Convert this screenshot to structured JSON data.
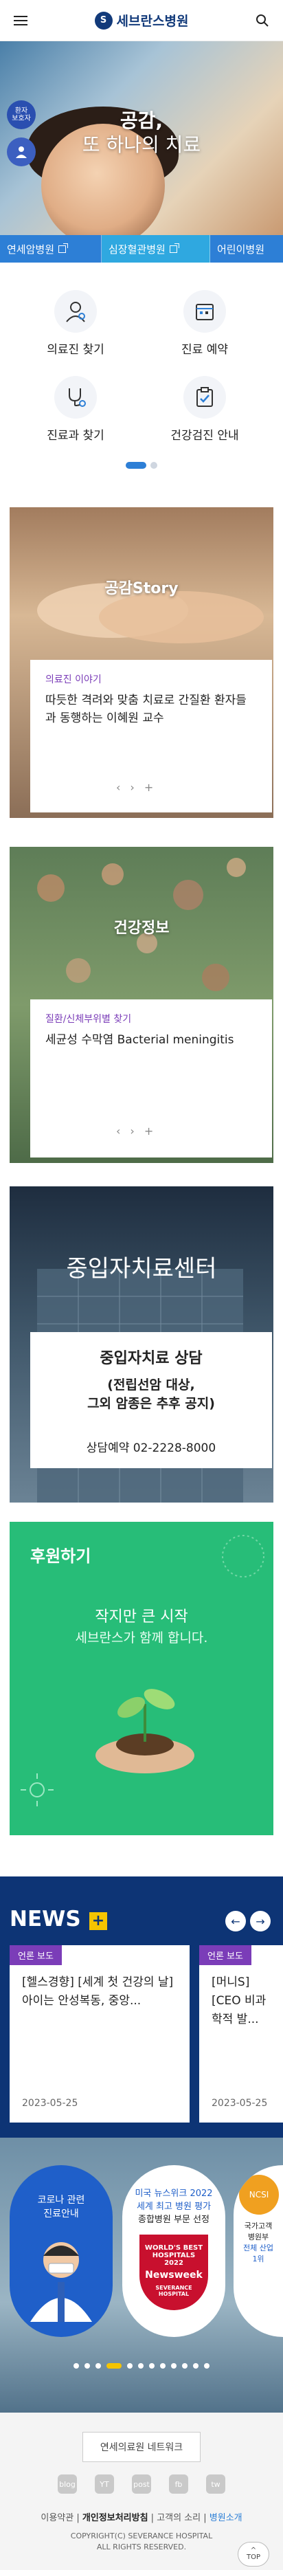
{
  "header": {
    "logo_text": "세브란스병원",
    "logo_mark": "S"
  },
  "hero": {
    "title_line1": "공감,",
    "title_line2": "또 하나의 치료",
    "side_button_label": "환자\n보호자"
  },
  "hospital_tabs": [
    {
      "label": "연세암병원"
    },
    {
      "label": "심장혈관병원"
    },
    {
      "label": "어린이병원"
    }
  ],
  "quick_menu": [
    {
      "label": "의료진 찾기",
      "icon": "doctor-search-icon"
    },
    {
      "label": "진료 예약",
      "icon": "calendar-icon"
    },
    {
      "label": "진료과 찾기",
      "icon": "stethoscope-icon"
    },
    {
      "label": "건강검진 안내",
      "icon": "health-check-icon"
    }
  ],
  "story": {
    "title": "공감Story",
    "category": "의료진 이야기",
    "text": "따듯한 격려와 맞춤 치료로 간질환 환자들과 동행하는 이혜원 교수"
  },
  "health_info": {
    "title": "건강정보",
    "category": "질환/신체부위별 찾기",
    "text": "세균성 수막염 Bacterial meningitis"
  },
  "pager": {
    "prev": "‹",
    "next": "›",
    "add": "+"
  },
  "center": {
    "title": "중입자치료센터",
    "box_title": "중입자치료 상담",
    "box_sub1": "(전립선암 대상,",
    "box_sub2": "그외 암종은 추후 공지)",
    "phone": "상담예약 02-2228-8000"
  },
  "donate": {
    "title": "후원하기",
    "line1": "작지만 큰 시작",
    "line2": "세브란스가 함께 합니다."
  },
  "news": {
    "title": "NEWS",
    "plus": "+",
    "items": [
      {
        "tag": "언론 보도",
        "text": "[헬스경향] [세계 첫 건강의 날] 아이는 안성복동, 중앙...",
        "date": "2023-05-25"
      },
      {
        "tag": "언론 보도",
        "text": "[머니S] [CEO 비과학적 발...",
        "date": "2023-05-25"
      }
    ]
  },
  "banners": [
    {
      "text1": "코로나 관련",
      "text2": "진료안내"
    },
    {
      "text1": "미국 뉴스위크 2022",
      "text2": "세계 최고 병원 평가",
      "text3": "종합병원 부문 선정",
      "badge1": "WORLD'S BEST",
      "badge2": "HOSPITALS",
      "badge3": "2022",
      "badge4": "Newsweek",
      "badge5": "SEVERANCE HOSPITAL"
    },
    {
      "text1": "국가고객",
      "text2": "병원부",
      "text3": "전체 산업",
      "text4": "1위",
      "badge": "NCSI"
    }
  ],
  "footer": {
    "network_label": "연세의료원 네트워크",
    "sns": [
      "blog",
      "YT",
      "post",
      "fb",
      "tw"
    ],
    "links": [
      "이용약관",
      "개인정보처리방침",
      "고객의 소리",
      "병원소개"
    ],
    "copyright1": "COPYRIGHT(C) SEVERANCE HOSPITAL",
    "copyright2": "ALL RIGHTS RESERVED.",
    "top": "TOP"
  },
  "colors": {
    "brand_navy": "#123a7a",
    "tab_blue": "#2d7fd6",
    "story_purple": "#7b3db8",
    "donate_green": "#27bd78",
    "news_navy": "#0d3475"
  }
}
